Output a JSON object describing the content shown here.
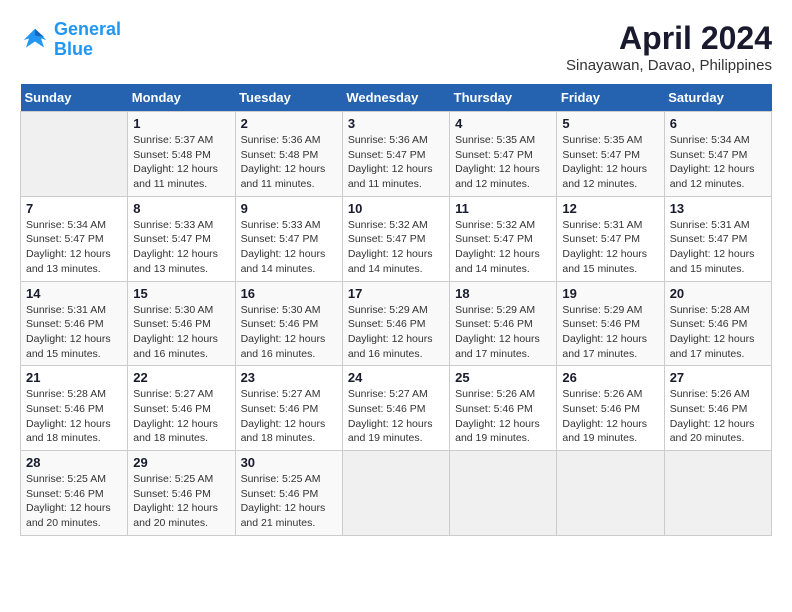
{
  "header": {
    "logo_line1": "General",
    "logo_line2": "Blue",
    "month": "April 2024",
    "location": "Sinayawan, Davao, Philippines"
  },
  "weekdays": [
    "Sunday",
    "Monday",
    "Tuesday",
    "Wednesday",
    "Thursday",
    "Friday",
    "Saturday"
  ],
  "weeks": [
    [
      {
        "day": null
      },
      {
        "day": 1,
        "sunrise": "5:37 AM",
        "sunset": "5:48 PM",
        "daylight": "12 hours and 11 minutes."
      },
      {
        "day": 2,
        "sunrise": "5:36 AM",
        "sunset": "5:48 PM",
        "daylight": "12 hours and 11 minutes."
      },
      {
        "day": 3,
        "sunrise": "5:36 AM",
        "sunset": "5:47 PM",
        "daylight": "12 hours and 11 minutes."
      },
      {
        "day": 4,
        "sunrise": "5:35 AM",
        "sunset": "5:47 PM",
        "daylight": "12 hours and 12 minutes."
      },
      {
        "day": 5,
        "sunrise": "5:35 AM",
        "sunset": "5:47 PM",
        "daylight": "12 hours and 12 minutes."
      },
      {
        "day": 6,
        "sunrise": "5:34 AM",
        "sunset": "5:47 PM",
        "daylight": "12 hours and 12 minutes."
      }
    ],
    [
      {
        "day": 7,
        "sunrise": "5:34 AM",
        "sunset": "5:47 PM",
        "daylight": "12 hours and 13 minutes."
      },
      {
        "day": 8,
        "sunrise": "5:33 AM",
        "sunset": "5:47 PM",
        "daylight": "12 hours and 13 minutes."
      },
      {
        "day": 9,
        "sunrise": "5:33 AM",
        "sunset": "5:47 PM",
        "daylight": "12 hours and 14 minutes."
      },
      {
        "day": 10,
        "sunrise": "5:32 AM",
        "sunset": "5:47 PM",
        "daylight": "12 hours and 14 minutes."
      },
      {
        "day": 11,
        "sunrise": "5:32 AM",
        "sunset": "5:47 PM",
        "daylight": "12 hours and 14 minutes."
      },
      {
        "day": 12,
        "sunrise": "5:31 AM",
        "sunset": "5:47 PM",
        "daylight": "12 hours and 15 minutes."
      },
      {
        "day": 13,
        "sunrise": "5:31 AM",
        "sunset": "5:47 PM",
        "daylight": "12 hours and 15 minutes."
      }
    ],
    [
      {
        "day": 14,
        "sunrise": "5:31 AM",
        "sunset": "5:46 PM",
        "daylight": "12 hours and 15 minutes."
      },
      {
        "day": 15,
        "sunrise": "5:30 AM",
        "sunset": "5:46 PM",
        "daylight": "12 hours and 16 minutes."
      },
      {
        "day": 16,
        "sunrise": "5:30 AM",
        "sunset": "5:46 PM",
        "daylight": "12 hours and 16 minutes."
      },
      {
        "day": 17,
        "sunrise": "5:29 AM",
        "sunset": "5:46 PM",
        "daylight": "12 hours and 16 minutes."
      },
      {
        "day": 18,
        "sunrise": "5:29 AM",
        "sunset": "5:46 PM",
        "daylight": "12 hours and 17 minutes."
      },
      {
        "day": 19,
        "sunrise": "5:29 AM",
        "sunset": "5:46 PM",
        "daylight": "12 hours and 17 minutes."
      },
      {
        "day": 20,
        "sunrise": "5:28 AM",
        "sunset": "5:46 PM",
        "daylight": "12 hours and 17 minutes."
      }
    ],
    [
      {
        "day": 21,
        "sunrise": "5:28 AM",
        "sunset": "5:46 PM",
        "daylight": "12 hours and 18 minutes."
      },
      {
        "day": 22,
        "sunrise": "5:27 AM",
        "sunset": "5:46 PM",
        "daylight": "12 hours and 18 minutes."
      },
      {
        "day": 23,
        "sunrise": "5:27 AM",
        "sunset": "5:46 PM",
        "daylight": "12 hours and 18 minutes."
      },
      {
        "day": 24,
        "sunrise": "5:27 AM",
        "sunset": "5:46 PM",
        "daylight": "12 hours and 19 minutes."
      },
      {
        "day": 25,
        "sunrise": "5:26 AM",
        "sunset": "5:46 PM",
        "daylight": "12 hours and 19 minutes."
      },
      {
        "day": 26,
        "sunrise": "5:26 AM",
        "sunset": "5:46 PM",
        "daylight": "12 hours and 19 minutes."
      },
      {
        "day": 27,
        "sunrise": "5:26 AM",
        "sunset": "5:46 PM",
        "daylight": "12 hours and 20 minutes."
      }
    ],
    [
      {
        "day": 28,
        "sunrise": "5:25 AM",
        "sunset": "5:46 PM",
        "daylight": "12 hours and 20 minutes."
      },
      {
        "day": 29,
        "sunrise": "5:25 AM",
        "sunset": "5:46 PM",
        "daylight": "12 hours and 20 minutes."
      },
      {
        "day": 30,
        "sunrise": "5:25 AM",
        "sunset": "5:46 PM",
        "daylight": "12 hours and 21 minutes."
      },
      {
        "day": null
      },
      {
        "day": null
      },
      {
        "day": null
      },
      {
        "day": null
      }
    ]
  ]
}
